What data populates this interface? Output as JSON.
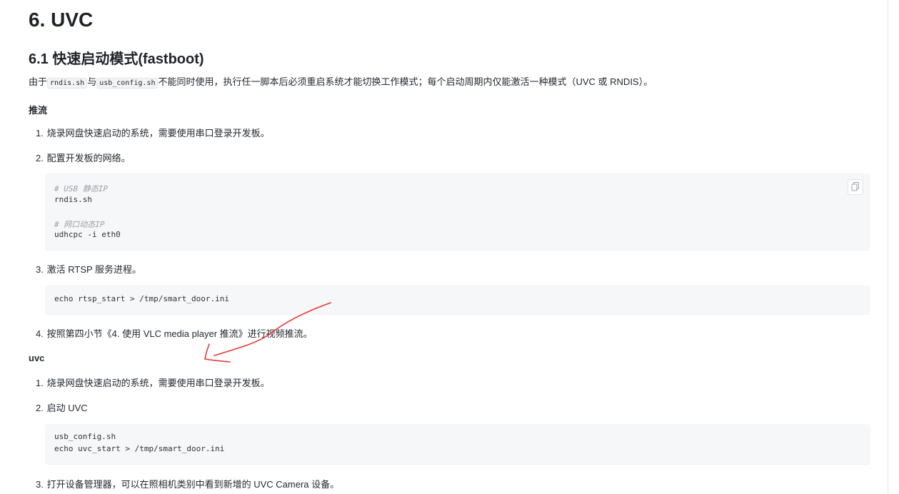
{
  "h1": "6. UVC",
  "h2": "6.1 快速启动模式(fastboot)",
  "intro": {
    "t1": "由于",
    "c1": "rndis.sh",
    "t2": "与",
    "c2": "usb_config.sh",
    "t3": "不能同时使用，执行任一脚本后必须重启系统才能切换工作模式；每个启动周期内仅能激活一种模式（UVC 或 RNDIS）。"
  },
  "push": {
    "title": "推流",
    "i1": "烧录网盘快速启动的系统，需要使用串口登录开发板。",
    "i2": "配置开发板的网络。",
    "code1": {
      "l1": "# USB 静态IP",
      "l2": "rndis.sh",
      "l3": "# 网口动态IP",
      "l4": "udhcpc -i eth0"
    },
    "i3": "激活 RTSP 服务进程。",
    "code2": {
      "l1": "echo rtsp_start > /tmp/smart_door.ini"
    },
    "i4": "按照第四小节《4. 使用 VLC media player 推流》进行视频推流。"
  },
  "uvc": {
    "title": "uvc",
    "i1": "烧录网盘快速启动的系统，需要使用串口登录开发板。",
    "i2": "启动 UVC",
    "code1": {
      "l1": "usb_config.sh",
      "l2": "echo uvc_start > /tmp/smart_door.ini"
    },
    "i3": "打开设备管理器，可以在照相机类别中看到新增的 UVC Camera 设备。"
  },
  "nums": {
    "n1": "1.",
    "n2": "2.",
    "n3": "3.",
    "n4": "4."
  },
  "icons": {
    "copy": "copy-icon"
  },
  "colors": {
    "annotation": "#e53935"
  }
}
